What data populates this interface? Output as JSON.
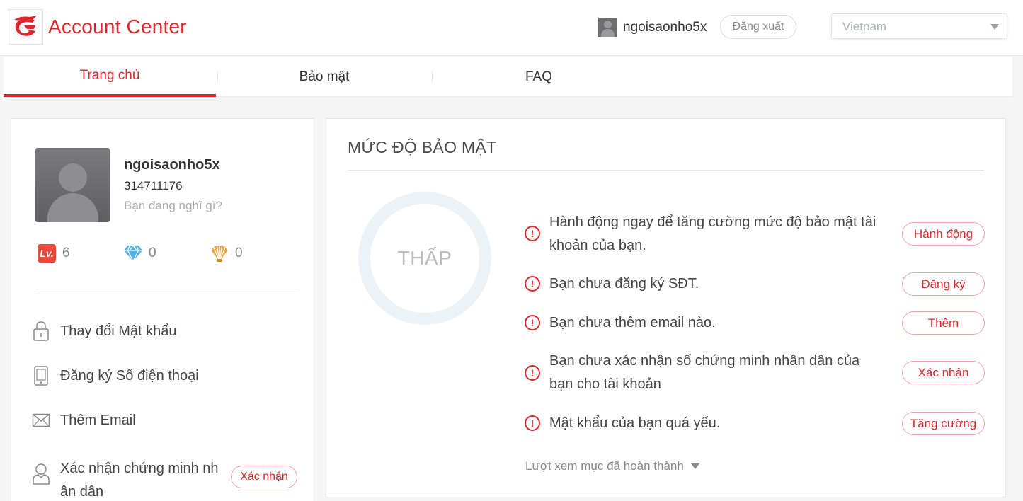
{
  "header": {
    "brand": "Account Center",
    "username": "ngoisaonho5x",
    "logout_label": "Đăng xuất",
    "language": "Vietnam",
    "brand_color": "#e1262b"
  },
  "tabs": [
    {
      "label": "Trang chủ",
      "active": true
    },
    {
      "label": "Bảo mật",
      "active": false
    },
    {
      "label": "FAQ",
      "active": false
    }
  ],
  "profile": {
    "name": "ngoisaonho5x",
    "id": "314711176",
    "status_placeholder": "Bạn đang nghĩ gì?",
    "stats": [
      {
        "icon": "level-icon",
        "icon_text": "Lv.",
        "value": "6"
      },
      {
        "icon": "diamond-icon",
        "value": "0"
      },
      {
        "icon": "shell-icon",
        "value": "0"
      }
    ]
  },
  "menu": {
    "change_password": "Thay đổi Mật khẩu",
    "register_phone": "Đăng ký Số điện thoại",
    "add_email": "Thêm Email",
    "verify_id": "Xác nhận chứng minh nhân dân",
    "verify_button": "Xác nhận"
  },
  "security": {
    "title": "MỨC ĐỘ BẢO MẬT",
    "level": "THẤP",
    "tasks": [
      {
        "text": "Hành động ngay để tăng cường mức độ bảo mật tài khoản của bạn.",
        "action": "Hành động"
      },
      {
        "text": "Bạn chưa đăng ký SĐT.",
        "action": "Đăng ký"
      },
      {
        "text": "Bạn chưa thêm email nào.",
        "action": "Thêm"
      },
      {
        "text": "Bạn chưa xác nhận số chứng minh nhân dân của bạn cho tài khoản",
        "action": "Xác nhận"
      },
      {
        "text": "Mật khẩu của bạn quá yếu.",
        "action": "Tăng cường"
      }
    ],
    "completed_link": "Lượt xem mục đã hoàn thành"
  }
}
